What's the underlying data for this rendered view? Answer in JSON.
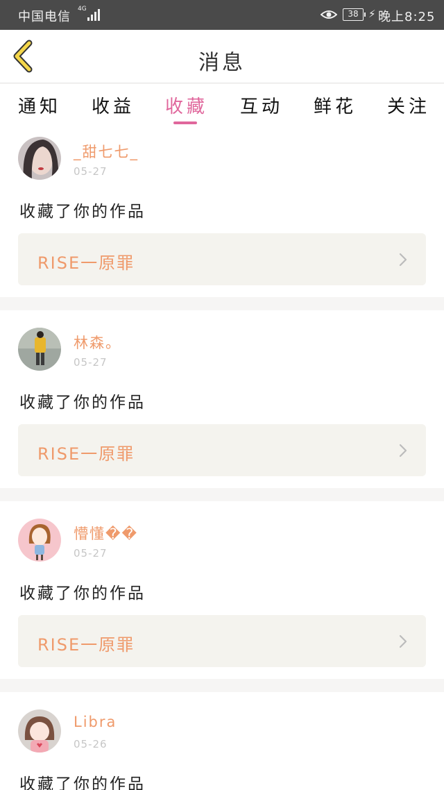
{
  "status_bar": {
    "carrier": "中国电信",
    "network": "4G",
    "battery": "38",
    "time": "晚上8:25"
  },
  "header": {
    "title": "消息"
  },
  "tabs": [
    {
      "label": "通知",
      "active": false
    },
    {
      "label": "收益",
      "active": false
    },
    {
      "label": "收藏",
      "active": true
    },
    {
      "label": "互动",
      "active": false
    },
    {
      "label": "鲜花",
      "active": false
    },
    {
      "label": "关注",
      "active": false
    }
  ],
  "colors": {
    "accent": "#e0679c",
    "username": "#ef9a6b",
    "status_bar": "#4a4a4a",
    "work_box": "#f4f3ee"
  },
  "messages": [
    {
      "user": "_甜七七_",
      "date": "05-27",
      "action": "收藏了你的作品",
      "work": "RISE一原罪"
    },
    {
      "user": "林森。",
      "date": "05-27",
      "action": "收藏了你的作品",
      "work": "RISE一原罪"
    },
    {
      "user": "懵懂��",
      "date": "05-27",
      "action": "收藏了你的作品",
      "work": "RISE一原罪"
    },
    {
      "user": "Libra",
      "date": "05-26",
      "action": "收藏了你的作品"
    }
  ]
}
